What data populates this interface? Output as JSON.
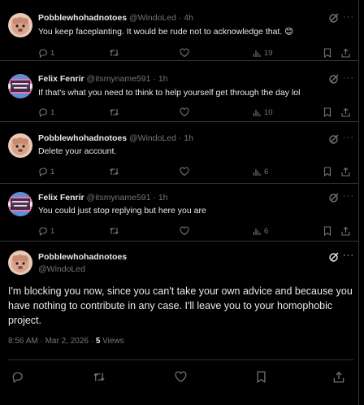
{
  "replies": [
    {
      "name": "Pobblewhohadnotoes",
      "handle": "@WindoLed",
      "time": "· 4h",
      "text": "You keep faceplanting. It would be rude not to acknowledge that. 😊",
      "reply_count": "1",
      "view_count": "19"
    },
    {
      "name": "Felix Fenrir",
      "handle": "@itsmyname591",
      "time": "· 1h",
      "text": "If that's what you need to think to help yourself get through the day lol",
      "reply_count": "1",
      "view_count": "10"
    },
    {
      "name": "Pobblewhohadnotoes",
      "handle": "@WindoLed",
      "time": "· 1h",
      "text": "Delete your account.",
      "reply_count": "1",
      "view_count": "6"
    },
    {
      "name": "Felix Fenrir",
      "handle": "@itsmyname591",
      "time": "· 1h",
      "text": "You could just stop replying but here you are",
      "reply_count": "1",
      "view_count": "6"
    }
  ],
  "main": {
    "name": "Pobblewhohadnotoes",
    "handle": "@WindoLed",
    "text": "I'm blocking you now, since you can't take your own advice and because you have nothing to contribute in any case. I'll leave you to your homophobic project.",
    "timestamp": "8:56 AM · Mar 2, 2026 · ",
    "views_number": "5",
    "views_label": " Views"
  },
  "dots_glyph": "···",
  "colors": {
    "background": "#000000",
    "text": "#e7e9ea",
    "muted": "#71767b",
    "border": "#2f3336"
  },
  "icons": [
    "reply-icon",
    "retweet-icon",
    "like-icon",
    "views-icon",
    "bookmark-icon",
    "share-icon",
    "grok-icon",
    "more-icon"
  ]
}
